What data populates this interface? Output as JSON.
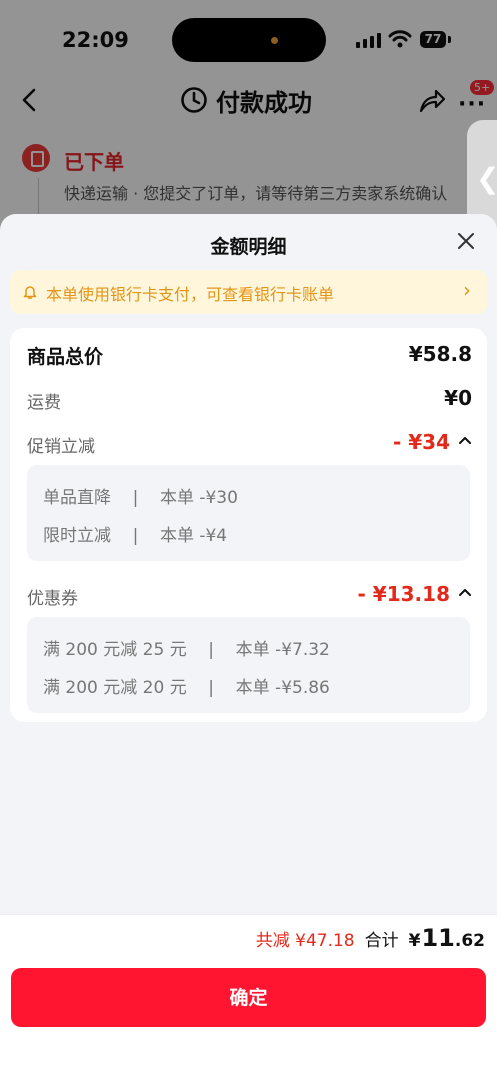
{
  "status_bar": {
    "time": "22:09",
    "battery": "77"
  },
  "nav": {
    "title": "付款成功",
    "badge": "5+"
  },
  "order": {
    "status": "已下单",
    "description": "快递运输 · 您提交了订单，请等待第三方卖家系统确认"
  },
  "sheet": {
    "title": "金额明细",
    "notice": "本单使用银行卡支付，可查看银行卡账单",
    "rows": {
      "goods_total": {
        "label": "商品总价",
        "value": "¥58.8"
      },
      "shipping": {
        "label": "运费",
        "value": "¥0"
      },
      "promo": {
        "label": "促销立减",
        "value": "- ¥34",
        "items": [
          {
            "text": "单品直降    |    本单 -¥30"
          },
          {
            "text": "限时立减    |    本单 -¥4"
          }
        ]
      },
      "coupon": {
        "label": "优惠券",
        "value": "- ¥13.18",
        "items": [
          {
            "text": "满 200 元减 25 元    |    本单 -¥7.32"
          },
          {
            "text": "满 200 元减 20 元    |    本单 -¥5.86"
          }
        ]
      }
    }
  },
  "footer": {
    "saved": "共减 ¥47.18",
    "total_label": "合计",
    "total_yen": "¥",
    "total_int": "11",
    "total_dec": ".62",
    "confirm_label": "确定"
  },
  "colors": {
    "accent_red": "#ff1530",
    "discount_red": "#e3291b",
    "notice_bg": "#fff6dc",
    "notice_text": "#e39516"
  }
}
